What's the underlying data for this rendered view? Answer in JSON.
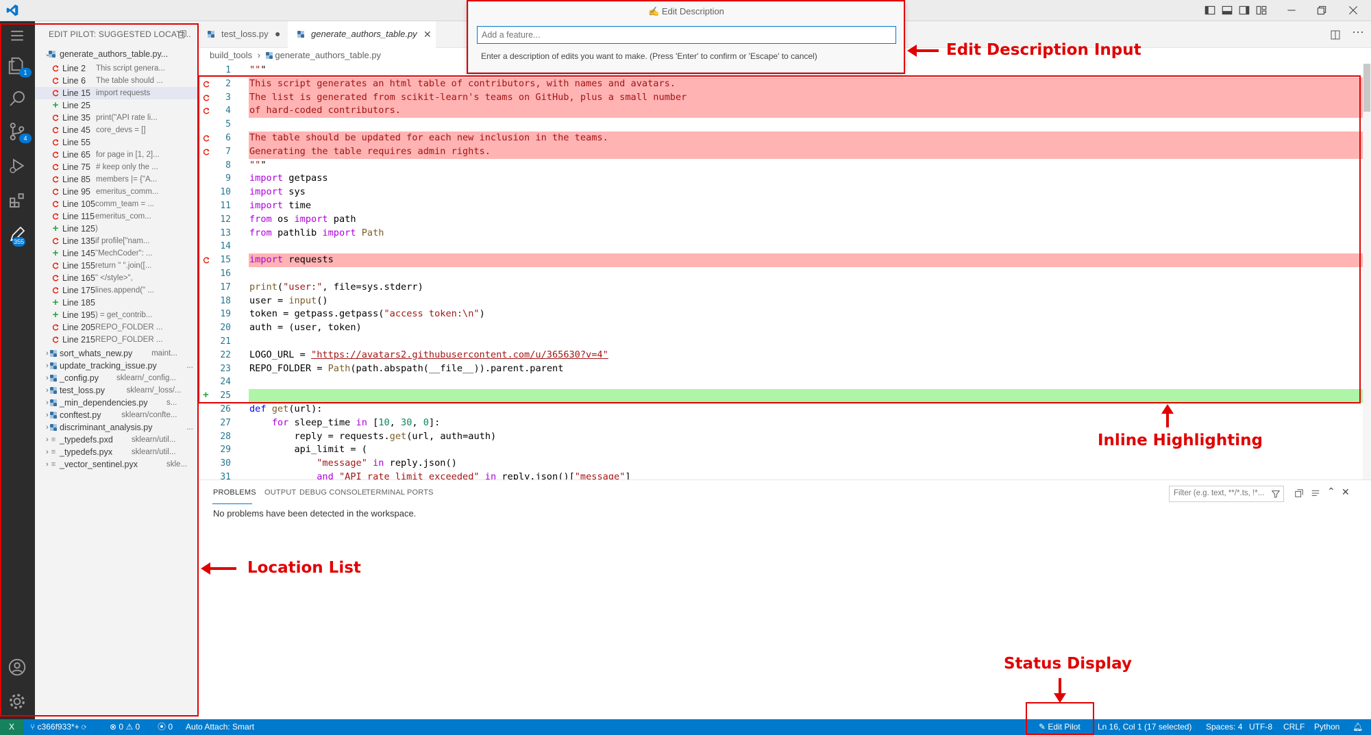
{
  "titlebar": {
    "icons": [
      "vscode-logo-icon",
      "layout-sidebar-icon",
      "layout-panel-icon",
      "layout-sidebar-right-icon",
      "customize-layout-icon",
      "minimize-icon",
      "restore-icon",
      "close-icon"
    ]
  },
  "activity_bar": {
    "items": [
      {
        "name": "menu-icon"
      },
      {
        "name": "explorer-icon",
        "badge": "1"
      },
      {
        "name": "search-icon"
      },
      {
        "name": "source-control-icon",
        "badge": "4"
      },
      {
        "name": "run-debug-icon"
      },
      {
        "name": "extensions-icon"
      },
      {
        "name": "edit-pilot-icon",
        "badge": "355"
      }
    ],
    "bottom": [
      {
        "name": "account-icon"
      },
      {
        "name": "settings-gear-icon"
      }
    ]
  },
  "sidebar": {
    "title": "EDIT PILOT: SUGGESTED LOCATI...",
    "root_file": {
      "name": "generate_authors_table.py..."
    },
    "locations": [
      {
        "icon": "replace",
        "line": "Line 2",
        "desc": "This script genera..."
      },
      {
        "icon": "replace",
        "line": "Line 6",
        "desc": "The table should ..."
      },
      {
        "icon": "replace",
        "line": "Line 15",
        "desc": "import requests",
        "selected": true
      },
      {
        "icon": "insert",
        "line": "Line 25",
        "desc": ""
      },
      {
        "icon": "replace",
        "line": "Line 35",
        "desc": "print(\"API rate li..."
      },
      {
        "icon": "replace",
        "line": "Line 45",
        "desc": "core_devs = []"
      },
      {
        "icon": "replace",
        "line": "Line 55",
        "desc": ""
      },
      {
        "icon": "replace",
        "line": "Line 65",
        "desc": "for page in [1, 2]..."
      },
      {
        "icon": "replace",
        "line": "Line 75",
        "desc": "# keep only the ..."
      },
      {
        "icon": "replace",
        "line": "Line 85",
        "desc": "members |= {\"A..."
      },
      {
        "icon": "replace",
        "line": "Line 95",
        "desc": "emeritus_comm..."
      },
      {
        "icon": "replace",
        "line": "Line 105",
        "desc": "comm_team = ..."
      },
      {
        "icon": "replace",
        "line": "Line 115",
        "desc": "emeritus_com..."
      },
      {
        "icon": "insert",
        "line": "Line 125",
        "desc": ")"
      },
      {
        "icon": "replace",
        "line": "Line 135",
        "desc": "if profile[\"nam..."
      },
      {
        "icon": "insert",
        "line": "Line 145",
        "desc": "\"MechCoder\": ..."
      },
      {
        "icon": "replace",
        "line": "Line 155",
        "desc": "return \" \".join([..."
      },
      {
        "icon": "replace",
        "line": "Line 165",
        "desc": "\"    </style>\","
      },
      {
        "icon": "replace",
        "line": "Line 175",
        "desc": "lines.append(\" ..."
      },
      {
        "icon": "insert",
        "line": "Line 185",
        "desc": ""
      },
      {
        "icon": "insert",
        "line": "Line 195",
        "desc": ") = get_contrib..."
      },
      {
        "icon": "replace",
        "line": "Line 205",
        "desc": "REPO_FOLDER ..."
      },
      {
        "icon": "replace",
        "line": "Line 215",
        "desc": "REPO_FOLDER ..."
      }
    ],
    "files": [
      {
        "name": "sort_whats_new.py",
        "desc": "maint...",
        "type": "py"
      },
      {
        "name": "update_tracking_issue.py",
        "desc": "...",
        "type": "py"
      },
      {
        "name": "_config.py",
        "desc": "sklearn/_config...",
        "type": "py"
      },
      {
        "name": "test_loss.py",
        "desc": "sklearn/_loss/...",
        "type": "py"
      },
      {
        "name": "_min_dependencies.py",
        "desc": "s...",
        "type": "py"
      },
      {
        "name": "conftest.py",
        "desc": "sklearn/confte...",
        "type": "py"
      },
      {
        "name": "discriminant_analysis.py",
        "desc": "...",
        "type": "py"
      },
      {
        "name": "_typedefs.pxd",
        "desc": "sklearn/util...",
        "type": "txt"
      },
      {
        "name": "_typedefs.pyx",
        "desc": "sklearn/util...",
        "type": "txt"
      },
      {
        "name": "_vector_sentinel.pyx",
        "desc": "skle...",
        "type": "txt"
      }
    ]
  },
  "tabs": [
    {
      "label": "test_loss.py",
      "modified": true,
      "active": false
    },
    {
      "label": "generate_authors_table.py",
      "active": true
    }
  ],
  "breadcrumb": {
    "folder": "build_tools",
    "file": "generate_authors_table.py"
  },
  "editor": {
    "lines": [
      {
        "n": "1",
        "text": "\"\"\"",
        "mark": ""
      },
      {
        "n": "2",
        "text": "This script generates an html table of contributors, with names and avatars.",
        "mark": "replace"
      },
      {
        "n": "3",
        "text": "The list is generated from scikit-learn's teams on GitHub, plus a small number",
        "mark": "replace"
      },
      {
        "n": "4",
        "text": "of hard-coded contributors.",
        "mark": "replace"
      },
      {
        "n": "5",
        "text": "",
        "mark": ""
      },
      {
        "n": "6",
        "text": "The table should be updated for each new inclusion in the teams.",
        "mark": "replace"
      },
      {
        "n": "7",
        "text": "Generating the table requires admin rights.",
        "mark": "replace"
      },
      {
        "n": "8",
        "text": "\"\"\"",
        "mark": ""
      },
      {
        "n": "9",
        "text": "import getpass",
        "mark": ""
      },
      {
        "n": "10",
        "text": "import sys",
        "mark": ""
      },
      {
        "n": "11",
        "text": "import time",
        "mark": ""
      },
      {
        "n": "12",
        "text": "from os import path",
        "mark": ""
      },
      {
        "n": "13",
        "text": "from pathlib import Path",
        "mark": ""
      },
      {
        "n": "14",
        "text": "",
        "mark": ""
      },
      {
        "n": "15",
        "text": "import requests",
        "mark": "replace"
      },
      {
        "n": "16",
        "text": "",
        "mark": ""
      },
      {
        "n": "17",
        "text": "print(\"user:\", file=sys.stderr)",
        "mark": ""
      },
      {
        "n": "18",
        "text": "user = input()",
        "mark": ""
      },
      {
        "n": "19",
        "text": "token = getpass.getpass(\"access token:\\n\")",
        "mark": ""
      },
      {
        "n": "20",
        "text": "auth = (user, token)",
        "mark": ""
      },
      {
        "n": "21",
        "text": "",
        "mark": ""
      },
      {
        "n": "22",
        "text": "LOGO_URL = \"https://avatars2.githubusercontent.com/u/365630?v=4\"",
        "mark": ""
      },
      {
        "n": "23",
        "text": "REPO_FOLDER = Path(path.abspath(__file__)).parent.parent",
        "mark": ""
      },
      {
        "n": "24",
        "text": "",
        "mark": ""
      },
      {
        "n": "25",
        "text": "",
        "mark": "insert"
      },
      {
        "n": "26",
        "text": "def get(url):",
        "mark": ""
      },
      {
        "n": "27",
        "text": "    for sleep_time in [10, 30, 0]:",
        "mark": ""
      },
      {
        "n": "28",
        "text": "        reply = requests.get(url, auth=auth)",
        "mark": ""
      },
      {
        "n": "29",
        "text": "        api_limit = (",
        "mark": ""
      },
      {
        "n": "30",
        "text": "            \"message\" in reply.json()",
        "mark": ""
      },
      {
        "n": "31",
        "text": "            and \"API rate limit exceeded\" in reply.json()[\"message\"]",
        "mark": ""
      }
    ]
  },
  "panel": {
    "tabs": [
      "PROBLEMS",
      "OUTPUT",
      "DEBUG CONSOLE",
      "TERMINAL",
      "PORTS"
    ],
    "active_tab": "PROBLEMS",
    "filter_placeholder": "Filter (e.g. text, **/*.ts, !*...",
    "message": "No problems have been detected in the workspace."
  },
  "palette": {
    "title": "Edit Description",
    "placeholder": "Add a feature...",
    "hint": "Enter a description of edits you want to make. (Press 'Enter' to confirm or 'Escape' to cancel)"
  },
  "statusbar": {
    "remote": "X",
    "branch": "c366f933*+",
    "errors": "0",
    "warnings": "0",
    "ports": "0",
    "auto_attach": "Auto Attach: Smart",
    "edit_pilot": "Edit Pilot",
    "cursor": "Ln 16, Col 1 (17 selected)",
    "spaces": "Spaces: 4",
    "encoding": "UTF-8",
    "eol": "CRLF",
    "language": "Python"
  },
  "annotations": {
    "edit_description_input": "Edit Description Input",
    "inline_highlighting": "Inline Highlighting",
    "location_list": "Location List",
    "status_display": "Status Display"
  },
  "colors": {
    "status_bar": "#007acc",
    "delete_highlight": "#ffb3b3",
    "insert_highlight": "#aef5a7",
    "annotation": "#e00000"
  }
}
